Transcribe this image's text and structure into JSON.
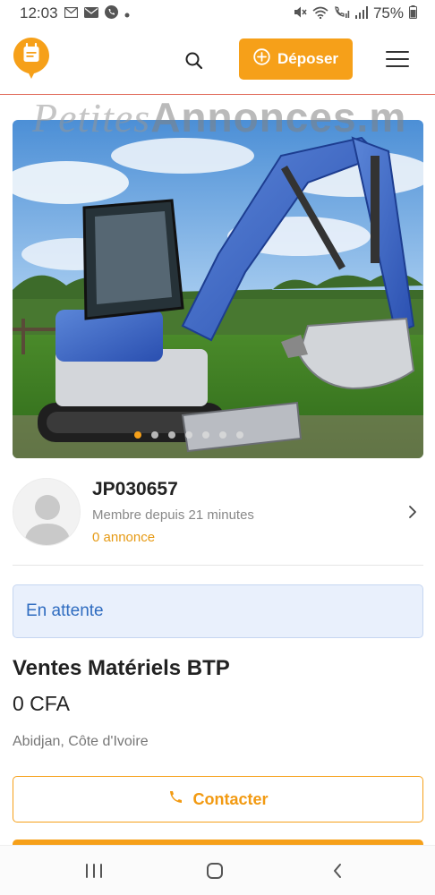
{
  "status_bar": {
    "time": "12:03",
    "left_icons": [
      "gmail-icon",
      "mail-icon",
      "phone-icon",
      "dot-icon"
    ],
    "right_icons": [
      "mute-icon",
      "wifi-icon",
      "call-signal-icon",
      "signal-icon"
    ],
    "battery": "75%"
  },
  "header": {
    "deposer_label": "Déposer",
    "accent_color": "#f6a019"
  },
  "listing": {
    "watermark_part1": "Petites",
    "watermark_part2": "Annonces.m",
    "photo_count": 7,
    "active_photo": 1
  },
  "seller": {
    "name": "JP030657",
    "member_since": "Membre depuis 21 minutes",
    "ads_count": "0 annonce"
  },
  "status": {
    "label": "En attente"
  },
  "ad": {
    "title": "Ventes Matériels BTP",
    "price": "0 CFA",
    "location": "Abidjan, Côte d'Ivoire"
  },
  "actions": {
    "contact_label": "Contacter"
  }
}
